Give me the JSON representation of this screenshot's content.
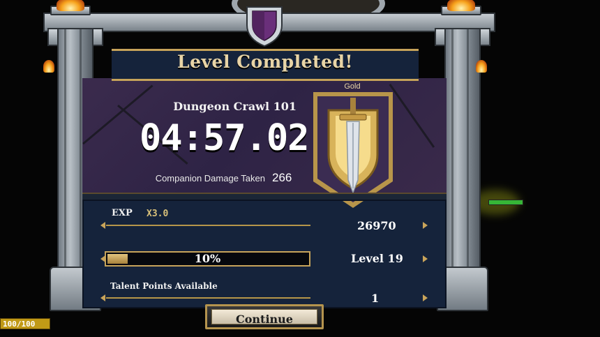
{
  "window": {
    "title": "Level Completed!"
  },
  "results": {
    "level_name": "Dungeon Crawl 101",
    "completion_time": "04:57.02",
    "companion_damage_label": "Companion Damage Taken",
    "companion_damage_value": "266",
    "medal": "Gold"
  },
  "exp": {
    "label": "EXP",
    "multiplier": "X3.0",
    "value": "26970"
  },
  "level": {
    "progress_text": "10%",
    "progress_fraction": 0.1,
    "label": "Level 19"
  },
  "talent": {
    "label": "Talent Points Available",
    "value": "1"
  },
  "buttons": {
    "continue": "Continue"
  },
  "hud": {
    "health_text": "100/100"
  },
  "colors": {
    "gold_accent": "#c6a35a",
    "panel": "#15233b",
    "upper_panel": "#2e2345"
  }
}
